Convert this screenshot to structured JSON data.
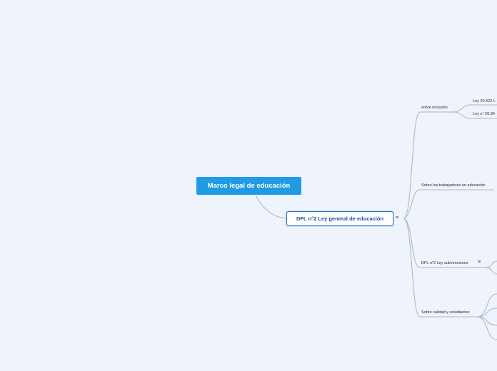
{
  "root": {
    "label": "Marco legal de educación"
  },
  "main": {
    "label": "DFL n°2 Ley general de educación"
  },
  "branches": [
    {
      "label": "sobre inclusión"
    },
    {
      "label": "Sobre los trabajadores en educación"
    },
    {
      "label": "DFL n°2 Ley subvenciones"
    },
    {
      "label": "Sobre calidad y estudiantes"
    }
  ],
  "subtopics": [
    {
      "label": "Ley 20.422 L"
    },
    {
      "label": "Ley n° 20.84"
    }
  ],
  "icons": {
    "notes": "≡"
  },
  "colors": {
    "background": "#eef3fc",
    "root_fill": "#1f9be6",
    "main_border": "#1f6fc4",
    "connector": "#a9b4c4"
  }
}
